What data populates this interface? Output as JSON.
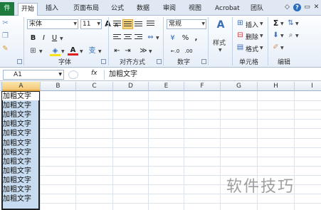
{
  "ribbon_tabs": {
    "file": "件",
    "home": "开始",
    "insert": "插入",
    "page_layout": "页面布局",
    "formulas": "公式",
    "data": "数据",
    "review": "审阅",
    "view": "视图",
    "acrobat": "Acrobat",
    "team": "团队"
  },
  "window_controls": {
    "minimize": "◇",
    "help": "?",
    "restore": "▭",
    "close": "✕"
  },
  "ribbon": {
    "font_name": "宋体",
    "font_size": "11",
    "number_format": "常规",
    "number_percent": "%",
    "number_comma": ",",
    "decimal_increase": "←.0",
    "decimal_decrease": ".00",
    "insert_label": "插入",
    "delete_label": "删除",
    "format_label": "格式",
    "style_label": "样式",
    "sum_symbol": "Σ",
    "groups": {
      "font": "字体",
      "alignment": "对齐方式",
      "number": "数字",
      "cells": "单元格",
      "editing": "编辑"
    },
    "bold": "B",
    "italic": "I",
    "underline": "U",
    "grow_font": "A",
    "shrink_font": "A",
    "font_color_letter": "A"
  },
  "formula_bar": {
    "name_box": "A1",
    "fx": "fx",
    "content": "加粗文字"
  },
  "columns": [
    "A",
    "B",
    "C",
    "D",
    "E",
    "F",
    "G",
    "H",
    "I"
  ],
  "cells": [
    "加粗文字",
    "加粗文字",
    "加粗文字",
    "加粗文字",
    "加粗文字",
    "加粗文字",
    "加粗文字",
    "加粗文字",
    "加粗文字",
    "加粗文字",
    "加粗文字",
    "加粗文字"
  ],
  "watermark": "软件技巧",
  "colors": {
    "file_tab": "#1f7a3d",
    "selection": "#c7dcf0",
    "active_header": "#f4c97a",
    "font_color": "#e02020"
  }
}
